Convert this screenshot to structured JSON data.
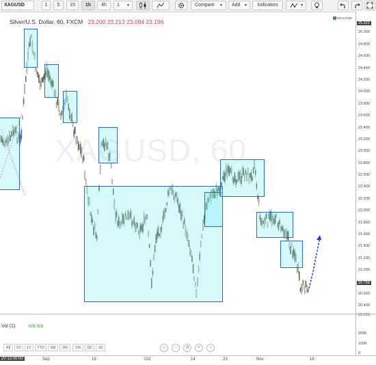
{
  "toolbar": {
    "symbol": "XAGUSD",
    "intervals": [
      "1",
      "5",
      "15",
      "1h",
      "4h",
      "1"
    ],
    "active_interval": "1h",
    "compare_label": "Compare",
    "add_label": "Add",
    "indicators_label": "Indicators"
  },
  "header": {
    "title": "Silver/U.S. Dollar, 60, FXCM",
    "ohlc": [
      "23.200",
      "23.213",
      "23.094",
      "23.196"
    ],
    "realtime_label": "REALTIME"
  },
  "watermark": "XAGUSD, 60",
  "price_axis": [
    "25.322",
    "25.000",
    "24.800",
    "24.600",
    "24.400",
    "24.200",
    "24.000",
    "23.800",
    "23.600",
    "23.400",
    "23.200",
    "23.000",
    "22.800",
    "22.600",
    "22.400",
    "22.200",
    "22.000",
    "21.800",
    "21.600",
    "21.400",
    "21.200",
    "21.000",
    "20.758",
    "20.600",
    "20.400",
    "20.200"
  ],
  "current_price": "20.758",
  "volume": {
    "label": "Vol (1)",
    "values": "n/a n/a",
    "axis": [
      "200K",
      "100K",
      "0"
    ]
  },
  "ranges": [
    "1D",
    "5D",
    "1M",
    "3M",
    "6M",
    "YTD",
    "1Y",
    "5Y",
    "All"
  ],
  "time_axis": {
    "cursor_label": "20 13:00:00",
    "labels": [
      "Sep",
      "16",
      "Oct",
      "14",
      "23",
      "Nov",
      "18"
    ]
  },
  "colors": {
    "box_fill": "#7ee8f2",
    "box_border": "#2a6bbf",
    "candle": "#4a5a40",
    "projection": "#1a3fd0",
    "price_tag": "#444444"
  }
}
